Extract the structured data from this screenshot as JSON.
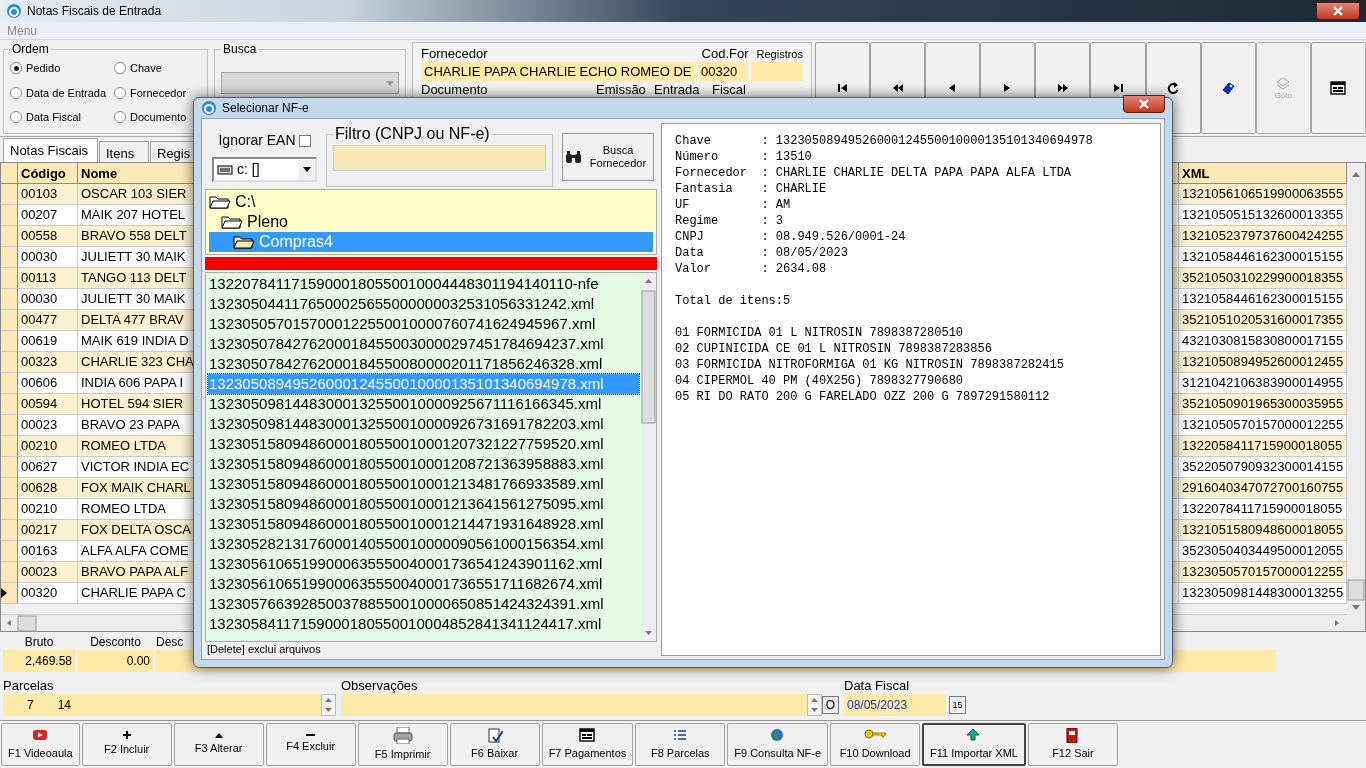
{
  "window": {
    "title": "Notas Fiscais de Entrada"
  },
  "menu": {
    "label": "Menu",
    "disabled": true
  },
  "ordem": {
    "title": "Ordem",
    "options": [
      {
        "label": "Pedido",
        "selected": true
      },
      {
        "label": "Chave",
        "selected": false
      },
      {
        "label": "Data de Entrada",
        "selected": false
      },
      {
        "label": "Fornecedor",
        "selected": false
      },
      {
        "label": "Data Fiscal",
        "selected": false
      },
      {
        "label": "Documento",
        "selected": false
      }
    ]
  },
  "busca": {
    "title": "Busca",
    "disabled": true
  },
  "fornecedor_panel": {
    "fornecedor_label": "Fornecedor",
    "fornecedor": "CHARLIE PAPA CHARLIE ECHO ROMEO DE",
    "cod_for_label": "Cod.For",
    "cod_for": "00320",
    "registros_label": "Registros",
    "row2_labels": [
      "Documento",
      "Emissão",
      "Entrada",
      "Fiscal"
    ]
  },
  "nav_buttons": [
    {
      "kind": "first",
      "disabled": false
    },
    {
      "kind": "prev_page",
      "disabled": false
    },
    {
      "kind": "prev",
      "disabled": false
    },
    {
      "kind": "next",
      "disabled": false
    },
    {
      "kind": "next_page",
      "disabled": false
    },
    {
      "kind": "last",
      "disabled": false
    },
    {
      "kind": "refresh",
      "disabled": false
    },
    {
      "kind": "tag",
      "disabled": false
    },
    {
      "kind": "goto",
      "label": "Goto",
      "disabled": true
    },
    {
      "kind": "form",
      "disabled": false
    }
  ],
  "tabs": [
    {
      "label": "Notas Fiscais",
      "selected": true
    },
    {
      "label": "Itens",
      "selected": false
    },
    {
      "label": "Regis",
      "selected": false
    }
  ],
  "table": {
    "columns": [
      "Código",
      "Nome",
      "XML"
    ],
    "rows": [
      {
        "codigo": "00103",
        "nome": "OSCAR 103 SIER",
        "xml": "1321056106519900063555",
        "current": false
      },
      {
        "codigo": "00207",
        "nome": "MAIK 207 HOTEL",
        "xml": "1321050515132600013355",
        "current": false
      },
      {
        "codigo": "00558",
        "nome": "BRAVO 558 DELT",
        "xml": "1321052379737600424255",
        "current": false
      },
      {
        "codigo": "00030",
        "nome": "JULIETT 30 MAIK",
        "xml": "1321058446162300015155",
        "current": false
      },
      {
        "codigo": "00113",
        "nome": "TANGO 113 DELT",
        "xml": "3521050310229900018355",
        "current": false
      },
      {
        "codigo": "00030",
        "nome": "JULIETT 30 MAIK",
        "xml": "1321058446162300015155",
        "current": false
      },
      {
        "codigo": "00477",
        "nome": "DELTA 477 BRAV",
        "xml": "3521051020531600017355",
        "current": false
      },
      {
        "codigo": "00619",
        "nome": "MAIK 619 INDIA D",
        "xml": "4321030815830800017155",
        "current": false
      },
      {
        "codigo": "00323",
        "nome": "CHARLIE 323 CHA",
        "xml": "1321050894952600012455",
        "current": false
      },
      {
        "codigo": "00606",
        "nome": "INDIA 606 PAPA I",
        "xml": "3121042106383900014955",
        "current": false
      },
      {
        "codigo": "00594",
        "nome": "HOTEL 594 SIER",
        "xml": "3521050901965300035955",
        "current": false
      },
      {
        "codigo": "00023",
        "nome": "BRAVO 23 PAPA",
        "xml": "1321050570157000012255",
        "current": false
      },
      {
        "codigo": "00210",
        "nome": "ROMEO LTDA",
        "xml": "1322058411715900018055",
        "current": false
      },
      {
        "codigo": "00627",
        "nome": "VICTOR INDIA EC",
        "xml": "3522050790932300014155",
        "current": false
      },
      {
        "codigo": "00628",
        "nome": "FOX MAIK CHARL",
        "xml": "2916040347072700160755",
        "current": false
      },
      {
        "codigo": "00210",
        "nome": "ROMEO LTDA",
        "xml": "1322078411715900018055",
        "current": false
      },
      {
        "codigo": "00217",
        "nome": "FOX DELTA OSCA",
        "xml": "1321051580948600018055",
        "current": false
      },
      {
        "codigo": "00163",
        "nome": "ALFA ALFA COME",
        "xml": "3523050403449500012055",
        "current": false
      },
      {
        "codigo": "00023",
        "nome": "BRAVO PAPA ALF",
        "xml": "1323050570157000012255",
        "current": false
      },
      {
        "codigo": "00320",
        "nome": "CHARLIE PAPA C",
        "xml": "1323050981448300013255",
        "current": true
      }
    ]
  },
  "totals": {
    "labels": [
      "Bruto",
      "Desconto",
      "Desc"
    ],
    "values": [
      "2,469.58",
      "0.00"
    ]
  },
  "parcelas": {
    "label": "Parcelas",
    "values": [
      "7",
      "14"
    ]
  },
  "observacoes": {
    "label": "Observações",
    "button": "O"
  },
  "data_fiscal": {
    "label": "Data Fiscal",
    "value": "08/05/2023",
    "button": "15"
  },
  "function_keys": [
    {
      "label": "F1 Videoaula",
      "kind": "video",
      "selected": false
    },
    {
      "label": "F2 Incluir",
      "kind": "plus",
      "selected": false
    },
    {
      "label": "F3 Alterar",
      "kind": "up",
      "selected": false
    },
    {
      "label": "F4 Excluir",
      "kind": "minus",
      "selected": false
    },
    {
      "label": "F5 Imprimir",
      "kind": "printer",
      "selected": false
    },
    {
      "label": "F6 Baixar",
      "kind": "check",
      "selected": false
    },
    {
      "label": "F7 Pagamentos",
      "kind": "form",
      "selected": false
    },
    {
      "label": "F8 Parcelas",
      "kind": "list",
      "selected": false
    },
    {
      "label": "F9 Consulta NF-e",
      "kind": "globe",
      "selected": false
    },
    {
      "label": "F10 Download",
      "kind": "key",
      "selected": false
    },
    {
      "label": "F11 Importar XML",
      "kind": "import",
      "selected": true
    },
    {
      "label": "F12 Sair",
      "kind": "door",
      "selected": false
    }
  ],
  "dialog": {
    "title": "Selecionar NF-e",
    "ignorar_ean": {
      "label": "Ignorar EAN",
      "checked": false
    },
    "drive": "c: []",
    "filtro": {
      "title": "Filtro (CNPJ ou NF-e)"
    },
    "busca_button": "Busca Fornecedor",
    "folders": [
      {
        "name": "C:\\",
        "selected": false,
        "children": [
          {
            "name": "Pleno",
            "selected": false,
            "children": [
              {
                "name": "Compras4",
                "selected": true
              }
            ]
          }
        ]
      }
    ],
    "files": [
      {
        "name": "13220784117159000180550010004448301194140110-nfe",
        "selected": false
      },
      {
        "name": "1323050441176500025655000000032531056331242.xml",
        "selected": false
      },
      {
        "name": "1323050570157000122550010000760741624945967.xml",
        "selected": false
      },
      {
        "name": "13230507842762000184550030000297451784694237.xml",
        "selected": false
      },
      {
        "name": "13230507842762000184550080000201171856246328.xml",
        "selected": false
      },
      {
        "name": "13230508949526000124550010000135101340694978.xml",
        "selected": true
      },
      {
        "name": "13230509814483000132550010000925671116166345.xml",
        "selected": false
      },
      {
        "name": "13230509814483000132550010000926731691782203.xml",
        "selected": false
      },
      {
        "name": "13230515809486000180550010001207321227759520.xml",
        "selected": false
      },
      {
        "name": "13230515809486000180550010001208721363958883.xml",
        "selected": false
      },
      {
        "name": "13230515809486000180550010001213481766933589.xml",
        "selected": false
      },
      {
        "name": "13230515809486000180550010001213641561275095.xml",
        "selected": false
      },
      {
        "name": "13230515809486000180550010001214471931648928.xml",
        "selected": false
      },
      {
        "name": "13230528213176000140550010000090561000156354.xml",
        "selected": false
      },
      {
        "name": "13230561065199000635550040001736541243901162.xml",
        "selected": false
      },
      {
        "name": "13230561065199000635550040001736551711682674.xml",
        "selected": false
      },
      {
        "name": "13230576639285003788550010000650851424324391.xml",
        "selected": false
      },
      {
        "name": "13230584117159000180550010004852841341124417.xml",
        "selected": false
      }
    ],
    "status": "[Delete] exclui arquivos",
    "details": [
      "Chave       : 13230508949526000124550010000135101340694978",
      "Número      : 13510",
      "Fornecedor  : CHARLIE CHARLIE DELTA PAPA PAPA ALFA LTDA",
      "Fantasia    : CHARLIE",
      "UF          : AM",
      "Regime      : 3",
      "CNPJ        : 08.949.526/0001-24",
      "Data        : 08/05/2023",
      "Valor       : 2634.08"
    ],
    "total": "Total de itens:5",
    "items": [
      "01 FORMICIDA 01 L NITROSIN 7898387280510",
      "02 CUPINICIDA CE 01 L NITROSIN 7898387283856",
      "03 FORMICIDA NITROFORMIGA 01 KG NITROSIN 7898387282415",
      "04 CIPERMOL 40 PM (40X25G) 7898327790680",
      "05 RI DO RATO 200 G FARELADO OZZ 200 G 7897291580112"
    ]
  }
}
